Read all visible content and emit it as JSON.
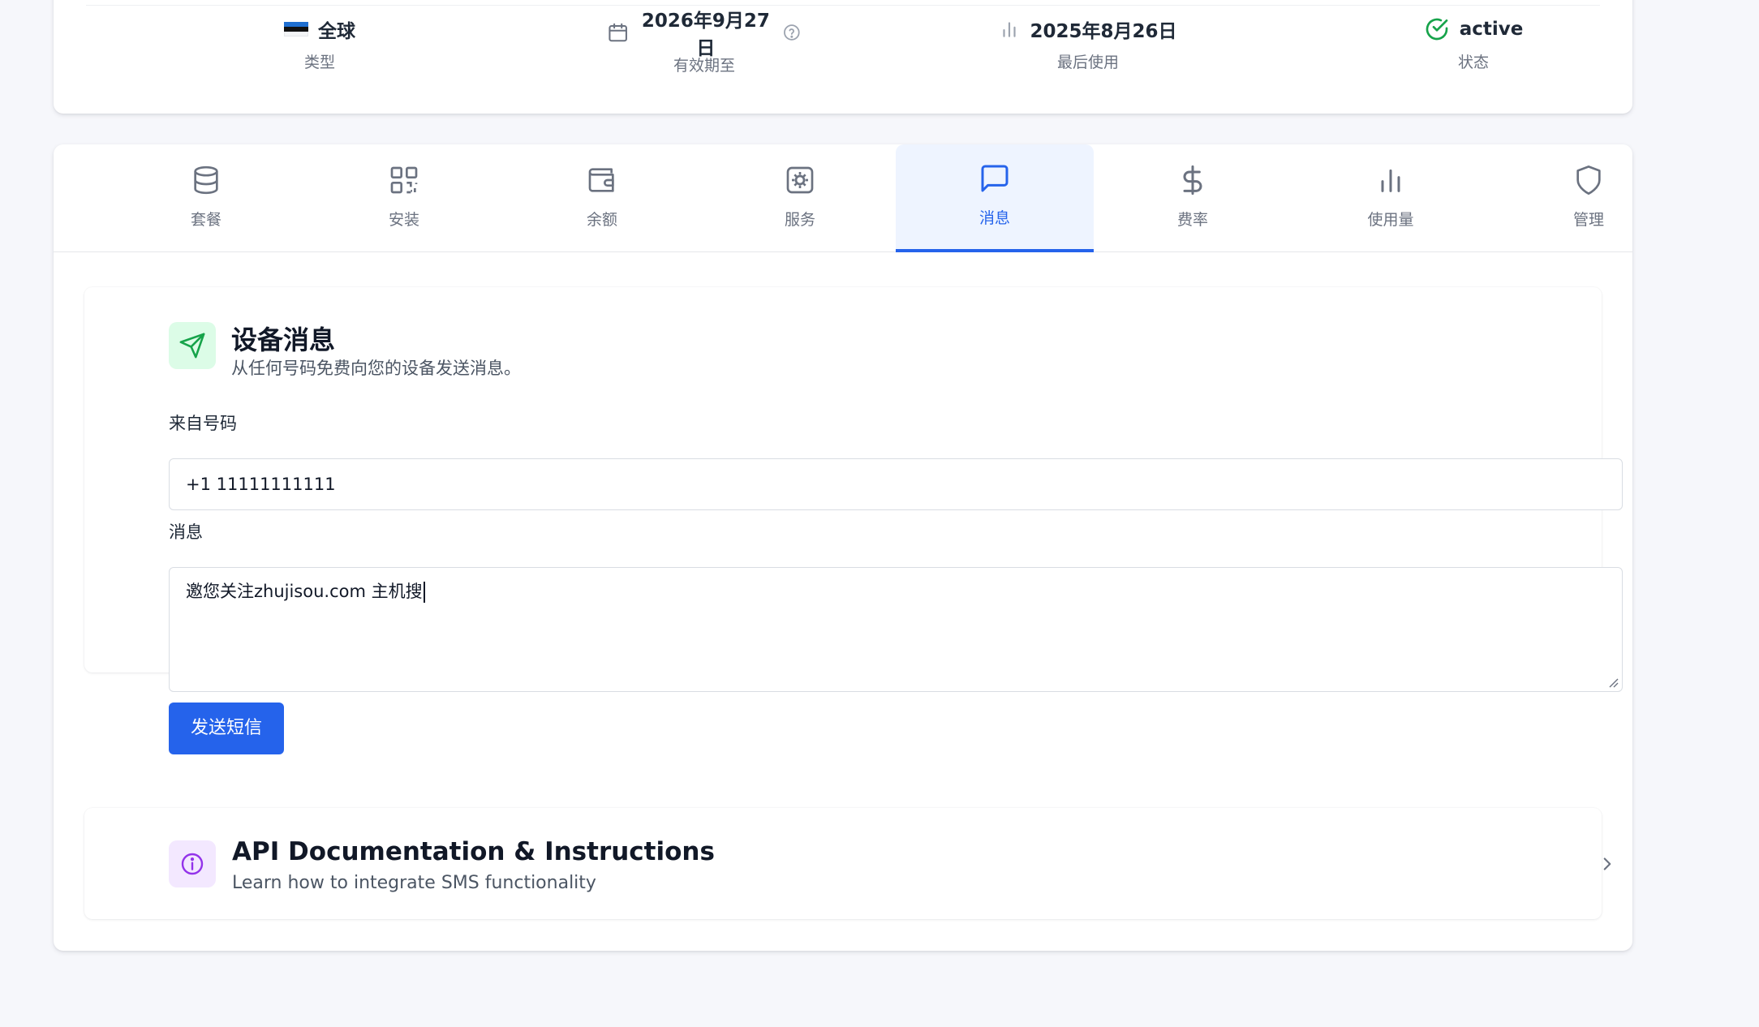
{
  "stats": [
    {
      "value": "全球",
      "label": "类型",
      "icon": "estonia-flag-icon"
    },
    {
      "value": "2026年9月27日",
      "label": "有效期至",
      "icon": "calendar-icon",
      "help_icon": "help-circle-icon"
    },
    {
      "value": "2025年8月26日",
      "label": "最后使用",
      "icon": "bar-chart-icon"
    },
    {
      "value": "active",
      "label": "状态",
      "icon": "check-circle-icon",
      "status_color": "#16a34a"
    }
  ],
  "tabs": [
    {
      "label": "套餐",
      "icon": "database-icon"
    },
    {
      "label": "安装",
      "icon": "qr-code-icon"
    },
    {
      "label": "余额",
      "icon": "wallet-icon"
    },
    {
      "label": "服务",
      "icon": "settings-icon"
    },
    {
      "label": "消息",
      "icon": "message-square-icon",
      "active": true
    },
    {
      "label": "费率",
      "icon": "dollar-icon"
    },
    {
      "label": "使用量",
      "icon": "bar-chart-icon"
    },
    {
      "label": "管理",
      "icon": "shield-icon"
    }
  ],
  "message_panel": {
    "title": "设备消息",
    "subtitle": "从任何号码免费向您的设备发送消息。",
    "icon": "send-icon",
    "from_label": "来自号码",
    "from_value": "+1 11111111111",
    "message_label": "消息",
    "message_value": "邀您关注zhujisou.com 主机搜",
    "send_label": "发送短信"
  },
  "api_panel": {
    "title": "API Documentation & Instructions",
    "subtitle": "Learn how to integrate SMS functionality",
    "icon": "info-icon",
    "chevron": "chevron-right-icon"
  },
  "colors": {
    "accent": "#2563eb",
    "active_tab_bg": "#eef4ff",
    "success": "#16a34a",
    "send_badge_bg": "#dcfce7",
    "info_badge_bg": "#f3e8ff",
    "info_color": "#9333ea"
  }
}
